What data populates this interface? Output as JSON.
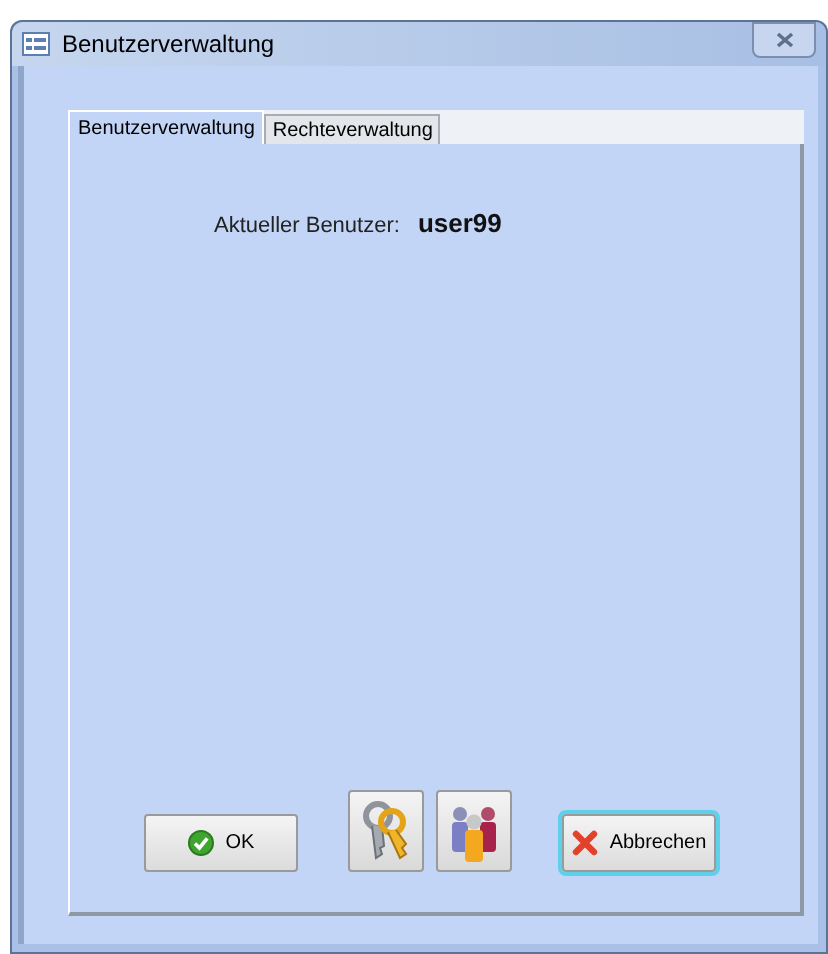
{
  "window": {
    "title": "Benutzerverwaltung"
  },
  "tabs": [
    {
      "label": "Benutzerverwaltung",
      "selected": true
    },
    {
      "label": "Rechteverwaltung",
      "selected": false
    }
  ],
  "current_user": {
    "label": "Aktueller Benutzer:",
    "value": "user99"
  },
  "buttons": [
    {
      "kind": "ok",
      "label": "OK",
      "focused": false
    },
    {
      "kind": "keys",
      "focused": false
    },
    {
      "kind": "users",
      "focused": false
    },
    {
      "kind": "cancel",
      "label": "Abbrechen",
      "focused": true
    }
  ]
}
